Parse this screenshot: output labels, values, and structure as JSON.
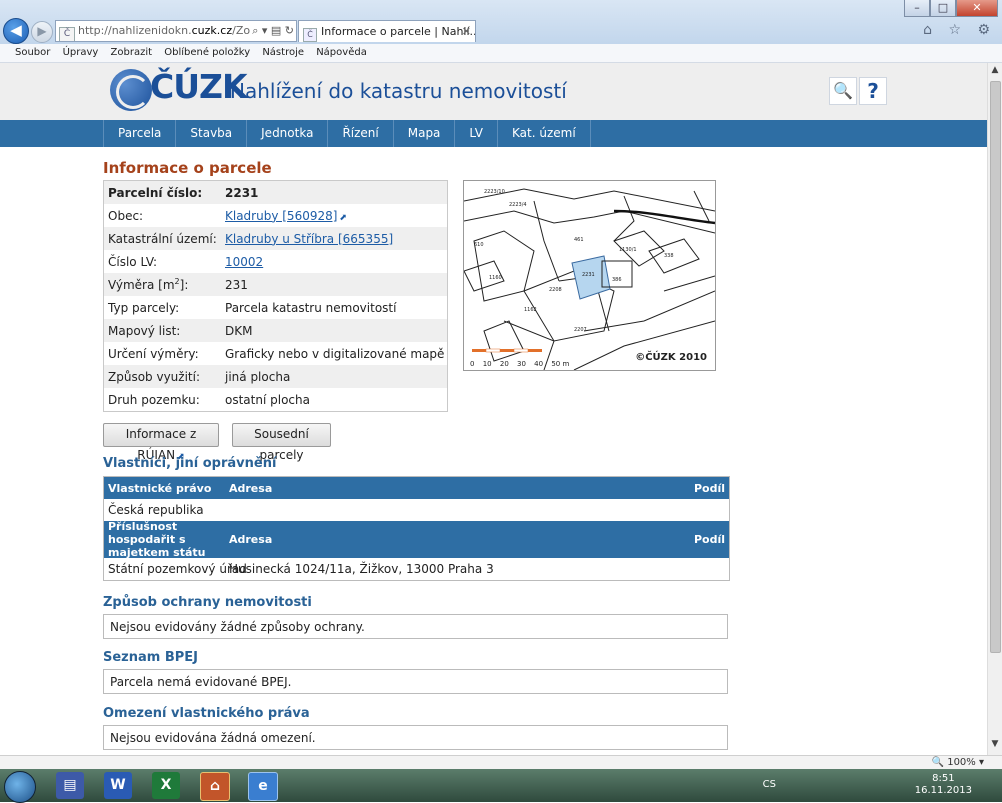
{
  "browser": {
    "address": {
      "prefix": "http://nahlizenidokn.",
      "domain": "cuzk.cz",
      "path": "/ZobrazOb",
      "tools": "⌕ ▾ ▤ ↻"
    },
    "tab_title": "Informace o parcele | Nahlí...",
    "tab_close": "✕",
    "menu": [
      "Soubor",
      "Úpravy",
      "Zobrazit",
      "Oblíbené položky",
      "Nástroje",
      "Nápověda"
    ],
    "right_icons": "⌂ ☆ ⚙"
  },
  "header": {
    "logo": "ČÚZK",
    "site_title": "Nahlížení do katastru nemovitostí",
    "search_icon": "search-icon",
    "help_label": "?"
  },
  "nav": [
    "Parcela",
    "Stavba",
    "Jednotka",
    "Řízení",
    "Mapa",
    "LV",
    "Kat. území"
  ],
  "parcel": {
    "heading": "Informace o parcele",
    "rows": [
      {
        "k": "Parcelní číslo:",
        "v": "2231"
      },
      {
        "k": "Obec:",
        "v": "Kladruby [560928]"
      },
      {
        "k": "Katastrální území:",
        "v": "Kladruby u Stříbra [665355]"
      },
      {
        "k": "Číslo LV:",
        "v": "10002"
      },
      {
        "k": "Výměra [m",
        "sup": "2",
        "k2": "]:",
        "v": "231"
      },
      {
        "k": "Typ parcely:",
        "v": "Parcela katastru nemovitostí"
      },
      {
        "k": "Mapový list:",
        "v": "DKM"
      },
      {
        "k": "Určení výměry:",
        "v": "Graficky nebo v digitalizované mapě"
      },
      {
        "k": "Způsob využití:",
        "v": "jiná plocha"
      },
      {
        "k": "Druh pozemku:",
        "v": "ostatní plocha"
      }
    ],
    "map_copyright": "©ČÚZK 2010",
    "scale_labels": [
      "0",
      "10",
      "20",
      "30",
      "40",
      "50 m"
    ]
  },
  "buttons": {
    "ruian": "Informace z RÚIAN",
    "neighbors": "Sousední parcely"
  },
  "owners": {
    "heading": "Vlastníci, jiní oprávnění",
    "head1": {
      "c1": "Vlastnické právo",
      "c2": "Adresa",
      "c3": "Podíl"
    },
    "row1": {
      "c1": "Česká republika",
      "c2": ""
    },
    "head2": {
      "c1": "Příslušnost hospodařit s majetkem státu",
      "c2": "Adresa",
      "c3": "Podíl"
    },
    "row2": {
      "c1": "Státní pozemkový úřad",
      "c2": "Husinecká 1024/11a, Žižkov, 13000 Praha 3"
    }
  },
  "protection": {
    "heading": "Způsob ochrany nemovitosti",
    "text": "Nejsou evidovány žádné způsoby ochrany."
  },
  "bpej": {
    "heading": "Seznam BPEJ",
    "text": "Parcela nemá evidované BPEJ."
  },
  "restrictions": {
    "heading": "Omezení vlastnického práva",
    "text": "Nejsou evidována žádná omezení."
  },
  "status": {
    "zoom": "100%"
  },
  "taskbar": {
    "lang": "CS",
    "time": "8:51",
    "date": "16.11.2013"
  }
}
